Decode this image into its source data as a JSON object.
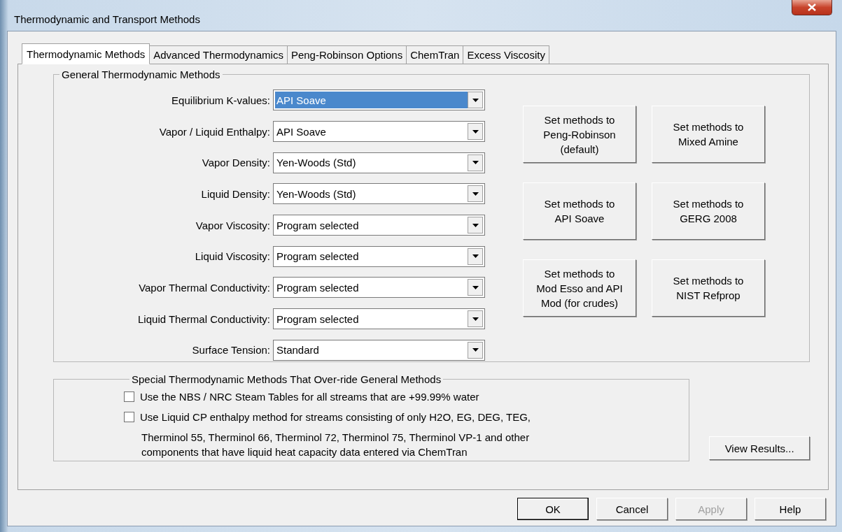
{
  "window": {
    "title": "Thermodynamic and Transport Methods"
  },
  "tabs": [
    {
      "label": "Thermodynamic Methods",
      "selected": true
    },
    {
      "label": "Advanced Thermodynamics",
      "selected": false
    },
    {
      "label": "Peng-Robinson Options",
      "selected": false
    },
    {
      "label": "ChemTran",
      "selected": false
    },
    {
      "label": "Excess Viscosity",
      "selected": false
    }
  ],
  "general_group": {
    "title": "General Thermodynamic Methods",
    "fields": [
      {
        "label": "Equilibrium K-values:",
        "value": "API Soave",
        "focused": true
      },
      {
        "label": "Vapor / Liquid Enthalpy:",
        "value": "API Soave",
        "focused": false
      },
      {
        "label": "Vapor Density:",
        "value": "Yen-Woods (Std)",
        "focused": false
      },
      {
        "label": "Liquid Density:",
        "value": "Yen-Woods (Std)",
        "focused": false
      },
      {
        "label": "Vapor Viscosity:",
        "value": "Program selected",
        "focused": false
      },
      {
        "label": "Liquid Viscosity:",
        "value": "Program selected",
        "focused": false
      },
      {
        "label": "Vapor Thermal Conductivity:",
        "value": "Program selected",
        "focused": false
      },
      {
        "label": "Liquid Thermal Conductivity:",
        "value": "Program selected",
        "focused": false
      },
      {
        "label": "Surface Tension:",
        "value": "Standard",
        "focused": false
      }
    ],
    "preset_buttons": [
      [
        "Set methods to",
        "Peng-Robinson",
        "(default)"
      ],
      [
        "Set methods to",
        "Mixed Amine"
      ],
      [
        "Set methods to",
        "API Soave"
      ],
      [
        "Set methods to",
        "GERG 2008"
      ],
      [
        "Set methods to",
        "Mod Esso and API",
        "Mod (for crudes)"
      ],
      [
        "Set methods to",
        "NIST Refprop"
      ]
    ]
  },
  "special_group": {
    "title": "Special Thermodynamic Methods That Over-ride General Methods",
    "options": [
      {
        "label": "Use the NBS / NRC Steam Tables for all streams that are +99.99% water",
        "checked": false
      },
      {
        "label": "Use Liquid CP enthalpy method for streams consisting of only H2O, EG, DEG, TEG,",
        "continuation": [
          "Therminol 55, Therminol 66, Therminol 72, Therminol 75, Therminol VP-1 and other",
          "components that have liquid heat capacity data entered via ChemTran"
        ],
        "checked": false
      }
    ]
  },
  "view_results_button": "View Results...",
  "buttons": [
    {
      "label": "OK",
      "disabled": false,
      "default": true
    },
    {
      "label": "Cancel",
      "disabled": false,
      "default": false
    },
    {
      "label": "Apply",
      "disabled": true,
      "default": false
    },
    {
      "label": "Help",
      "disabled": false,
      "default": false
    }
  ]
}
